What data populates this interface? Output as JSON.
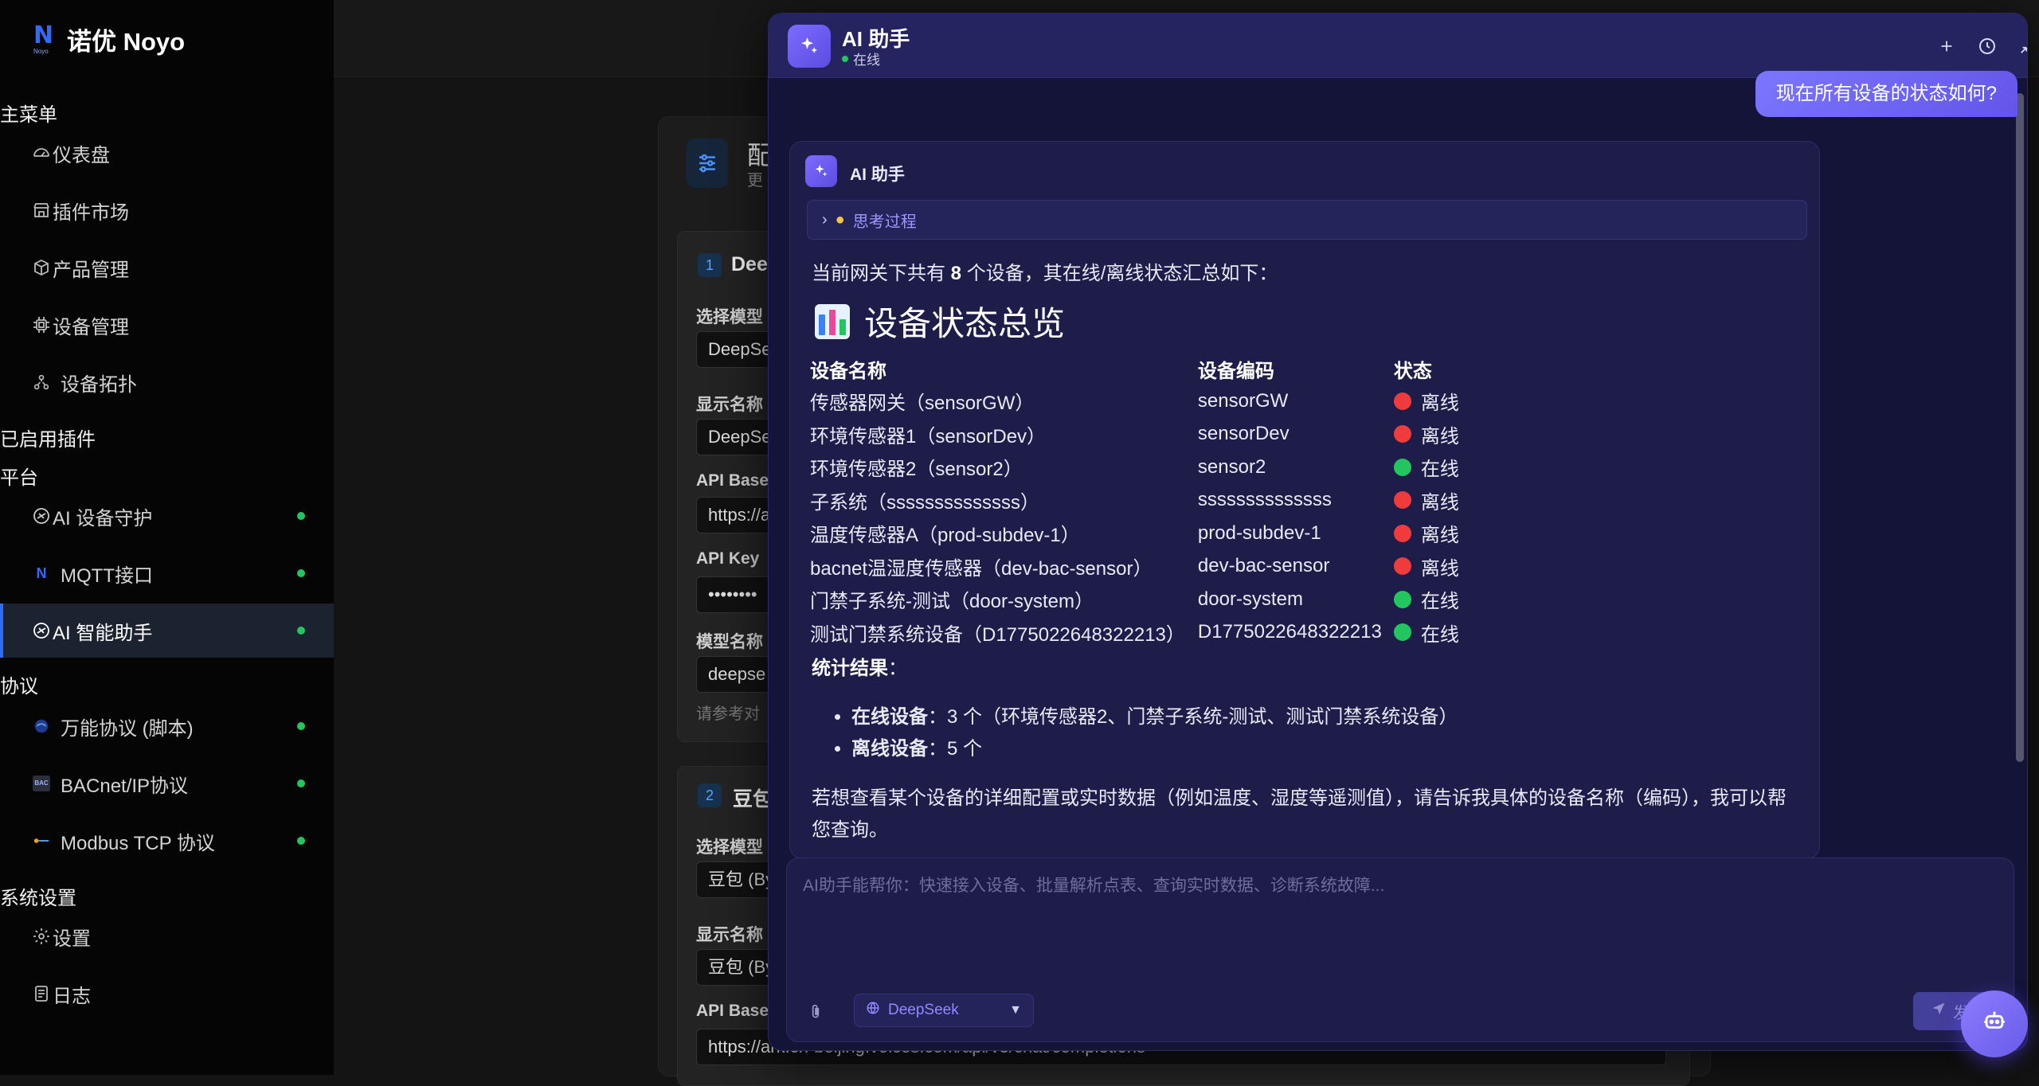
{
  "brand": {
    "name": "诺优 Noyo",
    "mark": "N",
    "mark_sub": "Noyo"
  },
  "sidebar": {
    "main_menu_title": "主菜单",
    "main_items": [
      {
        "label": "仪表盘",
        "icon": "dashboard-icon"
      },
      {
        "label": "插件市场",
        "icon": "store-icon"
      },
      {
        "label": "产品管理",
        "icon": "box-icon"
      },
      {
        "label": "设备管理",
        "icon": "chip-icon"
      },
      {
        "label": "设备拓扑",
        "icon": "topology-icon"
      }
    ],
    "plugins_title": "已启用插件",
    "platform_title": "平台",
    "platform_items": [
      {
        "label": "AI 设备守护",
        "icon": "ai-guard-icon"
      },
      {
        "label": "MQTT接口",
        "icon": "mqtt-icon"
      },
      {
        "label": "AI 智能助手",
        "icon": "ai-assistant-icon",
        "active": true
      }
    ],
    "protocol_title": "协议",
    "protocol_items": [
      {
        "label": "万能协议 (脚本)",
        "icon": "script-icon"
      },
      {
        "label": "BACnet/IP协议",
        "icon": "bacnet-icon"
      },
      {
        "label": "Modbus TCP 协议",
        "icon": "modbus-icon"
      }
    ],
    "system_title": "系统设置",
    "system_items": [
      {
        "label": "设置",
        "icon": "gear-icon"
      },
      {
        "label": "日志",
        "icon": "log-icon"
      }
    ]
  },
  "background_page": {
    "title": "配",
    "subtitle": "更",
    "sections": [
      {
        "num": "1",
        "title": "Dee",
        "fields": [
          {
            "label": "选择模型",
            "value": "DeepSe"
          },
          {
            "label": "显示名称",
            "value": "DeepSe"
          },
          {
            "label": "API Base",
            "value": "https://a"
          },
          {
            "label": "API Key",
            "value": "••••••••"
          },
          {
            "label": "模型名称",
            "value": "deepse"
          }
        ],
        "hint": "请参考对"
      },
      {
        "num": "2",
        "title": "豆包",
        "fields": [
          {
            "label": "选择模型",
            "value": "豆包 (By"
          },
          {
            "label": "显示名称",
            "value": "豆包 (By"
          },
          {
            "label": "API Base",
            "value": "https://ark.cn-beijing.volces.com/api/v3/chat/completions"
          }
        ]
      }
    ]
  },
  "assistant": {
    "title": "AI 助手",
    "status": "在线",
    "header_buttons": [
      "plus-icon",
      "history-icon",
      "minimize-icon",
      "close-icon"
    ],
    "user_message": "现在所有设备的状态如何?",
    "bot_name": "AI 助手",
    "thinking_label": "思考过程",
    "intro_prefix": "当前网关下共有 ",
    "intro_count": "8",
    "intro_suffix": " 个设备，其在线/离线状态汇总如下：",
    "heading": "设备状态总览",
    "table": {
      "headers": [
        "设备名称",
        "设备编码",
        "状态"
      ],
      "rows": [
        {
          "name": "传感器网关（sensorGW）",
          "code": "sensorGW",
          "status": "离线",
          "online": false
        },
        {
          "name": "环境传感器1（sensorDev）",
          "code": "sensorDev",
          "status": "离线",
          "online": false
        },
        {
          "name": "环境传感器2（sensor2）",
          "code": "sensor2",
          "status": "在线",
          "online": true
        },
        {
          "name": "子系统（ssssssssssssss）",
          "code": "ssssssssssssss",
          "status": "离线",
          "online": false
        },
        {
          "name": "温度传感器A（prod-subdev-1）",
          "code": "prod-subdev-1",
          "status": "离线",
          "online": false
        },
        {
          "name": "bacnet温湿度传感器（dev-bac-sensor）",
          "code": "dev-bac-sensor",
          "status": "离线",
          "online": false
        },
        {
          "name": "门禁子系统-测试（door-system）",
          "code": "door-system",
          "status": "在线",
          "online": true
        },
        {
          "name": "测试门禁系统设备（D1775022648322213）",
          "code": "D1775022648322213",
          "status": "在线",
          "online": true
        }
      ]
    },
    "stats_title": "统计结果",
    "stats_colon": "：",
    "stats": [
      {
        "label": "在线设备",
        "text": "：3 个（环境传感器2、门禁子系统-测试、测试门禁系统设备）"
      },
      {
        "label": "离线设备",
        "text": "：5 个"
      }
    ],
    "closing": "若想查看某个设备的详细配置或实时数据（例如温度、湿度等遥测值），请告诉我具体的设备名称（编码），我可以帮您查询。",
    "input_placeholder": "AI助手能帮你：快速接入设备、批量解析点表、查询实时数据、诊断系统故障...",
    "model": "DeepSeek",
    "send_label": "发送"
  },
  "colors": {
    "accent": "#6355e8",
    "online": "#22c55e",
    "offline": "#ef3b3b",
    "brand_blue": "#2f6bff"
  }
}
